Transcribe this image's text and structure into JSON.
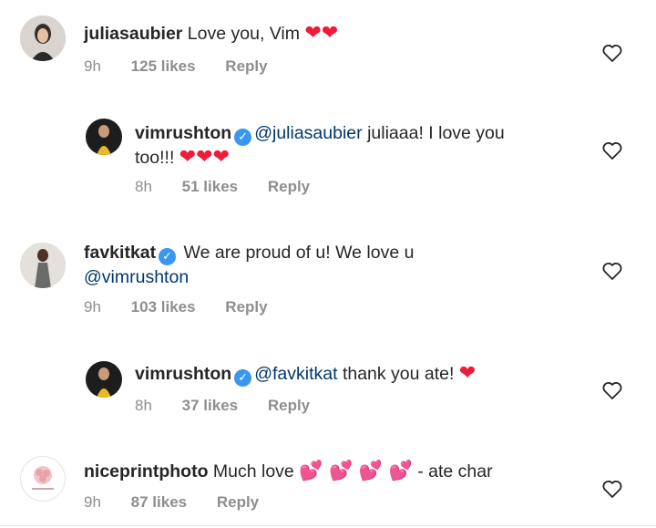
{
  "comments": [
    {
      "username": "juliasaubier",
      "text": "Love you, Vim",
      "hearts": "❤❤",
      "time": "9h",
      "likes": "125 likes",
      "reply": "Reply"
    },
    {
      "username": "vimrushton",
      "mention": "@juliasaubier",
      "text_line1": "juliaaa! I love you",
      "text_line2": "too!!!",
      "hearts": "❤❤❤",
      "time": "8h",
      "likes": "51 likes",
      "reply": "Reply"
    },
    {
      "username": "favkitkat",
      "text": "We are proud of u! We love u",
      "mention": "@vimrushton",
      "time": "9h",
      "likes": "103 likes",
      "reply": "Reply"
    },
    {
      "username": "vimrushton",
      "mention": "@favkitkat",
      "text": "thank you ate!",
      "hearts": "❤",
      "time": "8h",
      "likes": "37 likes",
      "reply": "Reply"
    },
    {
      "username": "niceprintphoto",
      "text": "Much love",
      "hearts": "💕 💕 💕 💕",
      "text_after": " - ate char",
      "time": "9h",
      "likes": "87 likes",
      "reply": "Reply"
    }
  ],
  "icons": {
    "like": "heart-outline-icon",
    "verified": "verified-badge-icon"
  },
  "colors": {
    "text": "#262626",
    "meta": "#8e8e8e",
    "mention": "#00376b",
    "verified": "#3897f0",
    "heart": "#ed1c3b"
  }
}
